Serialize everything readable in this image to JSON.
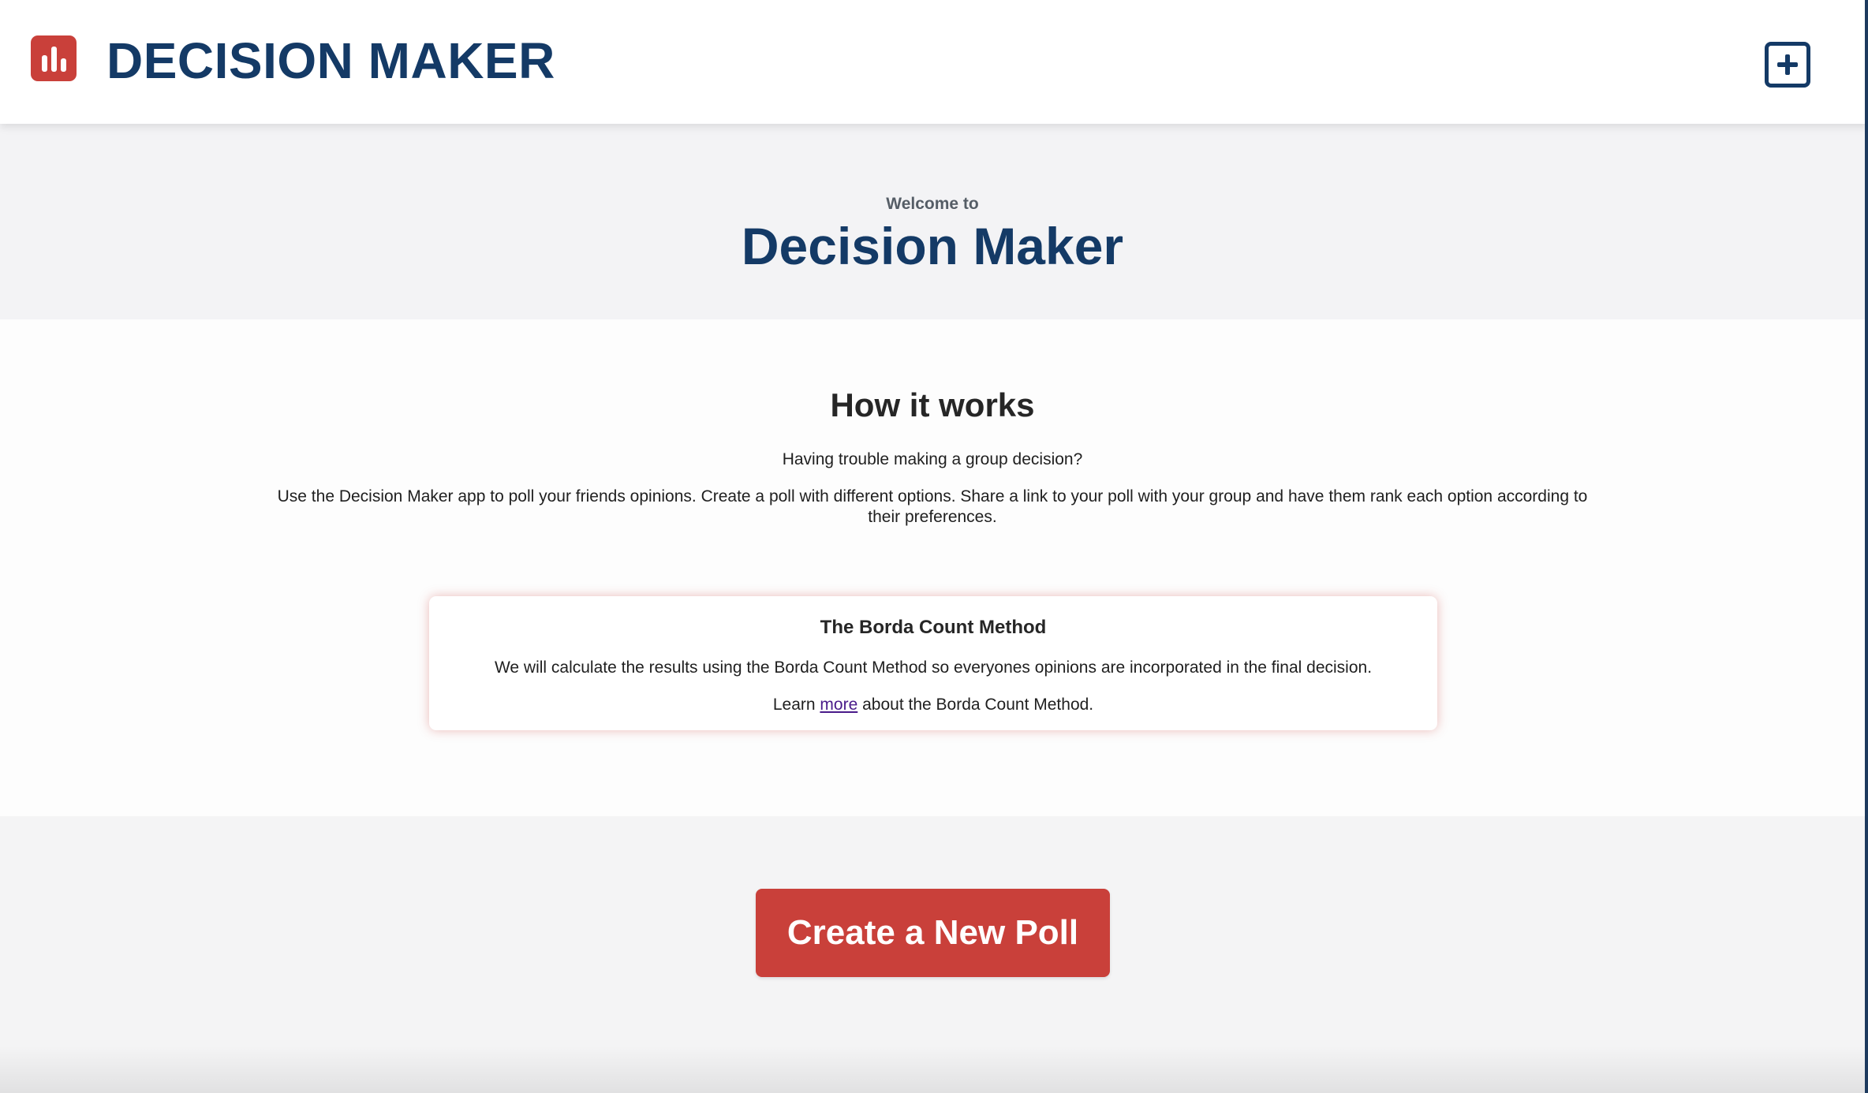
{
  "header": {
    "app_title": "DECISION MAKER",
    "logo_icon": "bar-chart-icon",
    "add_icon": "plus-square-icon"
  },
  "welcome": {
    "subtitle": "Welcome to",
    "title": "Decision Maker"
  },
  "how_it_works": {
    "title": "How it works",
    "question": "Having trouble making a group decision?",
    "description": "Use the Decision Maker app to poll your friends opinions. Create a poll with different options. Share a link to your poll with your group and have them rank each option according to their preferences."
  },
  "borda": {
    "title": "The Borda Count Method",
    "text": "We will calculate the results using the Borda Count Method so everyones opinions are incorporated in the final decision.",
    "learn_prefix": "Learn ",
    "learn_link": "more",
    "learn_suffix": " about the Borda Count Method."
  },
  "create": {
    "button_label": "Create a New Poll"
  },
  "colors": {
    "brand_navy": "#143a66",
    "brand_red": "#c9403a",
    "page_bg": "#f4f4f5"
  }
}
